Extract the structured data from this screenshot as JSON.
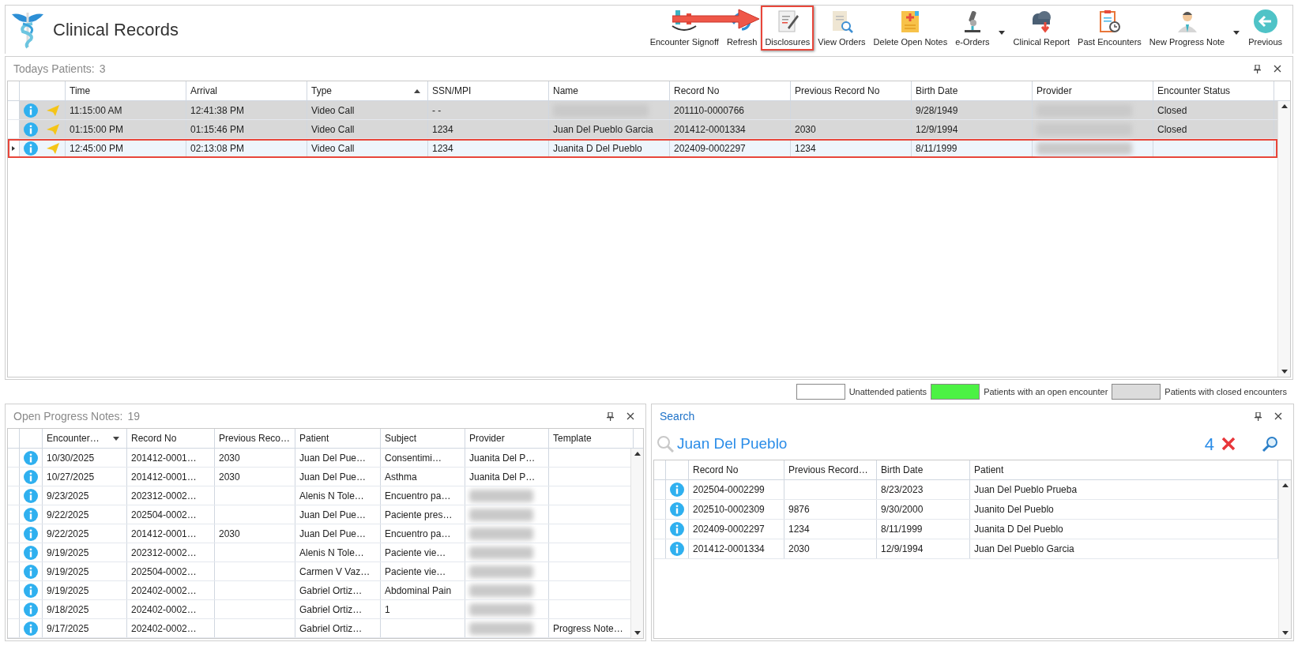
{
  "app": {
    "title": "Clinical Records"
  },
  "toolbar": [
    {
      "label": "Encounter Signoff",
      "highlighted": false,
      "dropdown": false
    },
    {
      "label": "Refresh",
      "highlighted": false,
      "dropdown": false
    },
    {
      "label": "Disclosures",
      "highlighted": true,
      "dropdown": false
    },
    {
      "label": "View Orders",
      "highlighted": false,
      "dropdown": false
    },
    {
      "label": "Delete Open Notes",
      "highlighted": false,
      "dropdown": false
    },
    {
      "label": "e-Orders",
      "highlighted": false,
      "dropdown": true
    },
    {
      "label": "Clinical Report",
      "highlighted": false,
      "dropdown": false
    },
    {
      "label": "Past Encounters",
      "highlighted": false,
      "dropdown": false
    },
    {
      "label": "New Progress Note",
      "highlighted": false,
      "dropdown": true
    },
    {
      "label": "Previous",
      "highlighted": false,
      "dropdown": false
    }
  ],
  "todays_patients": {
    "title": "Todays Patients:",
    "count": "3",
    "columns": [
      {
        "label": "Time",
        "sorted": false
      },
      {
        "label": "Arrival",
        "sorted": false
      },
      {
        "label": "Type",
        "sorted": true,
        "descending": false
      },
      {
        "label": "SSN/MPI",
        "sorted": false
      },
      {
        "label": "Name",
        "sorted": false
      },
      {
        "label": "Record No",
        "sorted": false
      },
      {
        "label": "Previous Record No",
        "sorted": false
      },
      {
        "label": "Birth Date",
        "sorted": false
      },
      {
        "label": "Provider",
        "sorted": false
      },
      {
        "label": "Encounter Status",
        "sorted": false
      }
    ],
    "rows": [
      {
        "selected": false,
        "closed": true,
        "cells": [
          "11:15:00 AM",
          "12:41:38 PM",
          "Video Call",
          "-  -",
          {
            "redacted": true
          },
          "201110-0000766",
          null,
          "9/28/1949",
          {
            "redacted": true
          },
          "Closed"
        ]
      },
      {
        "selected": false,
        "closed": true,
        "cells": [
          "01:15:00 PM",
          "01:15:46 PM",
          "Video Call",
          "1234",
          "Juan Del Pueblo Garcia",
          "201412-0001334",
          "2030",
          "12/9/1994",
          {
            "redacted": true
          },
          "Closed"
        ]
      },
      {
        "selected": true,
        "closed": false,
        "cells": [
          "12:45:00 PM",
          "02:13:08 PM",
          "Video Call",
          "1234",
          "Juanita D Del Pueblo",
          "202409-0002297",
          "1234",
          "8/11/1999",
          {
            "redacted": true
          },
          null
        ]
      }
    ]
  },
  "legend": [
    {
      "label": "Unattended patients",
      "color": "#ffffff"
    },
    {
      "label": "Patients with an open encounter",
      "color": "#4cf244"
    },
    {
      "label": "Patients with closed encounters",
      "color": "#dcdcdc"
    }
  ],
  "open_progress_notes": {
    "title": "Open Progress Notes:",
    "count": "19",
    "columns": [
      {
        "label": "Encounter…",
        "sorted": true,
        "descending": true
      },
      {
        "label": "Record No",
        "sorted": false
      },
      {
        "label": "Previous Reco…",
        "sorted": false
      },
      {
        "label": "Patient",
        "sorted": false
      },
      {
        "label": "Subject",
        "sorted": false
      },
      {
        "label": "Provider",
        "sorted": false
      },
      {
        "label": "Template",
        "sorted": false
      }
    ],
    "rows": [
      {
        "cells": [
          "10/30/2025",
          "201412-0001…",
          "2030",
          "Juan Del Pue…",
          "Consentimi…",
          "Juanita Del P…",
          null
        ]
      },
      {
        "cells": [
          "10/27/2025",
          "201412-0001…",
          "2030",
          "Juan Del Pue…",
          "Asthma",
          "Juanita Del P…",
          null
        ]
      },
      {
        "cells": [
          "9/23/2025",
          "202312-0002…",
          null,
          "Alenis N Tole…",
          "Encuentro pa…",
          {
            "redacted": true
          },
          null
        ]
      },
      {
        "cells": [
          "9/22/2025",
          "202504-0002…",
          null,
          "Juan Del Pue…",
          "Paciente pres…",
          {
            "redacted": true
          },
          null
        ]
      },
      {
        "cells": [
          "9/22/2025",
          "201412-0001…",
          "2030",
          "Juan Del Pue…",
          "Encuentro pa…",
          {
            "redacted": true
          },
          null
        ]
      },
      {
        "cells": [
          "9/19/2025",
          "202312-0002…",
          null,
          "Alenis N Tole…",
          "Paciente vie…",
          {
            "redacted": true
          },
          null
        ]
      },
      {
        "cells": [
          "9/19/2025",
          "202504-0002…",
          null,
          "Carmen V Vaz…",
          "Paciente vie…",
          {
            "redacted": true
          },
          null
        ]
      },
      {
        "cells": [
          "9/19/2025",
          "202402-0002…",
          null,
          "Gabriel Ortiz…",
          "Abdominal Pain",
          {
            "redacted": true
          },
          null
        ]
      },
      {
        "cells": [
          "9/18/2025",
          "202402-0002…",
          null,
          "Gabriel Ortiz…",
          "1",
          {
            "redacted": true
          },
          null
        ]
      },
      {
        "cells": [
          "9/17/2025",
          "202402-0002…",
          null,
          "Gabriel Ortiz…",
          null,
          {
            "redacted": true
          },
          "Progress Note…"
        ]
      }
    ]
  },
  "search": {
    "title": "Search",
    "value": "Juan Del Pueblo",
    "count": "4",
    "columns": [
      {
        "label": "Record No",
        "sorted": false
      },
      {
        "label": "Previous Record…",
        "sorted": false
      },
      {
        "label": "Birth Date",
        "sorted": false
      },
      {
        "label": "Patient",
        "sorted": false
      }
    ],
    "rows": [
      {
        "cells": [
          "202504-0002299",
          null,
          "8/23/2023",
          "Juan Del Pueblo Prueba"
        ]
      },
      {
        "cells": [
          "202510-0002309",
          "9876",
          "9/30/2000",
          "Juanito Del Pueblo"
        ]
      },
      {
        "cells": [
          "202409-0002297",
          "1234",
          "8/11/1999",
          "Juanita D Del Pueblo"
        ]
      },
      {
        "cells": [
          "201412-0001334",
          "2030",
          "12/9/1994",
          "Juan Del Pueblo Garcia"
        ]
      }
    ]
  }
}
